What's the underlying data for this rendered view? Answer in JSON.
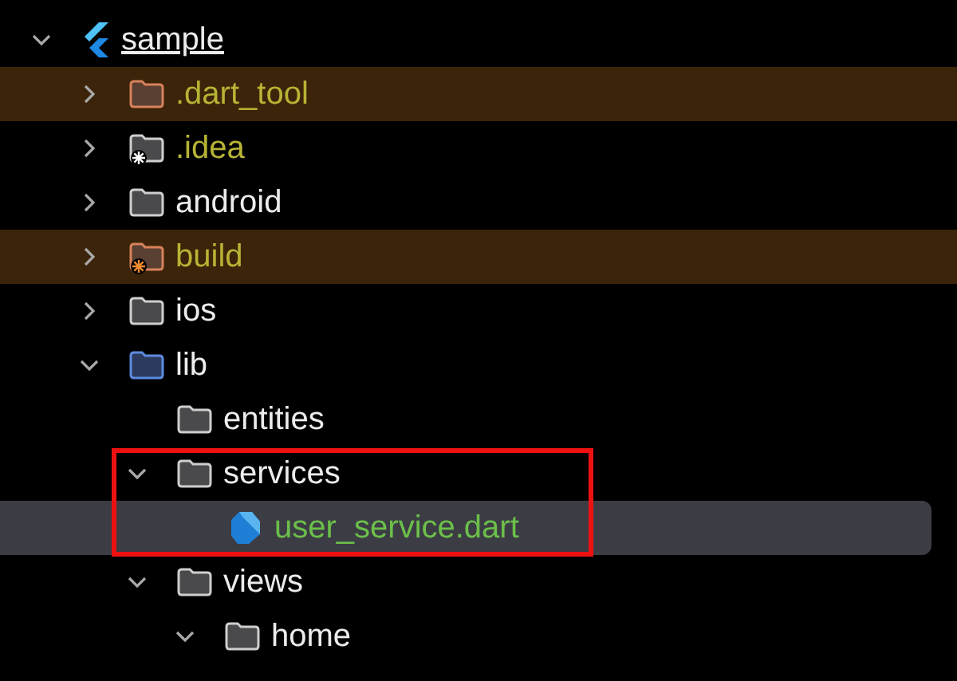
{
  "tree": [
    {
      "name": "sample",
      "kind": "project",
      "expanded": true,
      "selected": false,
      "children": [
        {
          "name": ".dart_tool",
          "kind": "excluded-folder",
          "expanded": false,
          "selected": false
        },
        {
          "name": ".idea",
          "kind": "config-folder",
          "expanded": false,
          "selected": false
        },
        {
          "name": "android",
          "kind": "folder",
          "expanded": false,
          "selected": false
        },
        {
          "name": "build",
          "kind": "excluded-build-folder",
          "expanded": false,
          "selected": false
        },
        {
          "name": "ios",
          "kind": "folder",
          "expanded": false,
          "selected": false
        },
        {
          "name": "lib",
          "kind": "source-folder",
          "expanded": true,
          "selected": false,
          "children": [
            {
              "name": "entities",
              "kind": "folder",
              "selected": false
            },
            {
              "name": "services",
              "kind": "folder",
              "expanded": true,
              "selected": false,
              "highlighted": true,
              "children": [
                {
                  "name": "user_service.dart",
                  "kind": "dart-file",
                  "selected": true,
                  "highlighted": true
                }
              ]
            },
            {
              "name": "views",
              "kind": "folder",
              "expanded": true,
              "selected": false,
              "children": [
                {
                  "name": "home",
                  "kind": "folder",
                  "expanded": true,
                  "selected": false
                }
              ]
            }
          ]
        }
      ]
    }
  ]
}
